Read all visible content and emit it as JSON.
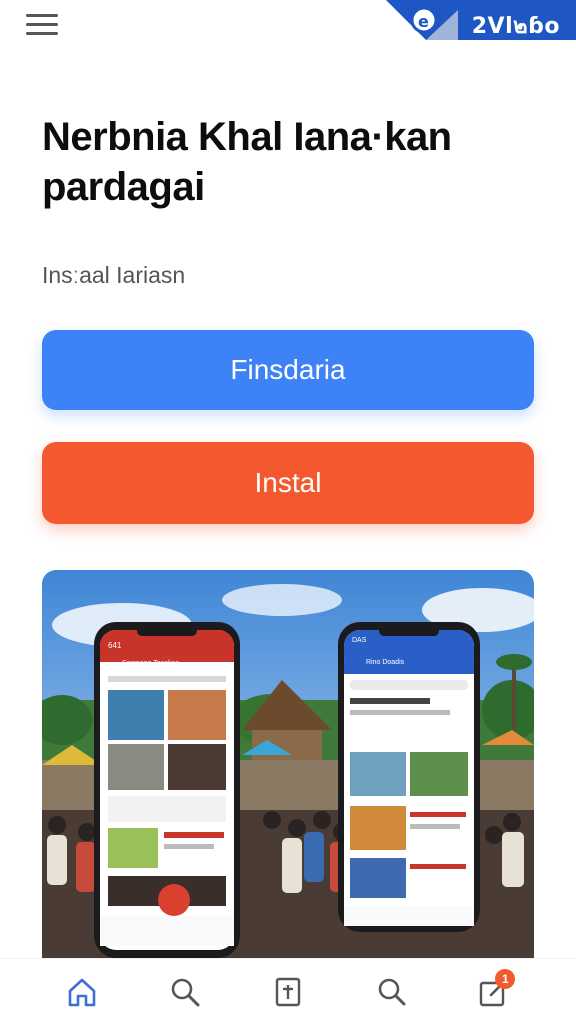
{
  "header": {
    "menu_icon": "hamburger-menu-icon",
    "badge_text": "2Vl๒ɓo"
  },
  "main": {
    "title_line1": "Nerbnia Khal Iana·kan",
    "title_line2": "pardagai",
    "subtitle": "Insːaal Iariasn",
    "primary_button": "Finsdaria",
    "install_button": "Instal"
  },
  "hero": {
    "phone_left_header": "Sosmeno Tasakas",
    "phone_right_header": "Rino Doadis",
    "phone_left_time": "641",
    "phone_right_time": "DAS"
  },
  "bottom_nav": {
    "items": [
      "home-icon",
      "search-icon",
      "bookmark-icon",
      "heart-icon",
      "edit-icon"
    ],
    "notification_count": "1"
  },
  "colors": {
    "primary": "#3d82f6",
    "install": "#f4582e",
    "nav_active": "#3d6fd6",
    "nav_inactive": "#555555"
  }
}
